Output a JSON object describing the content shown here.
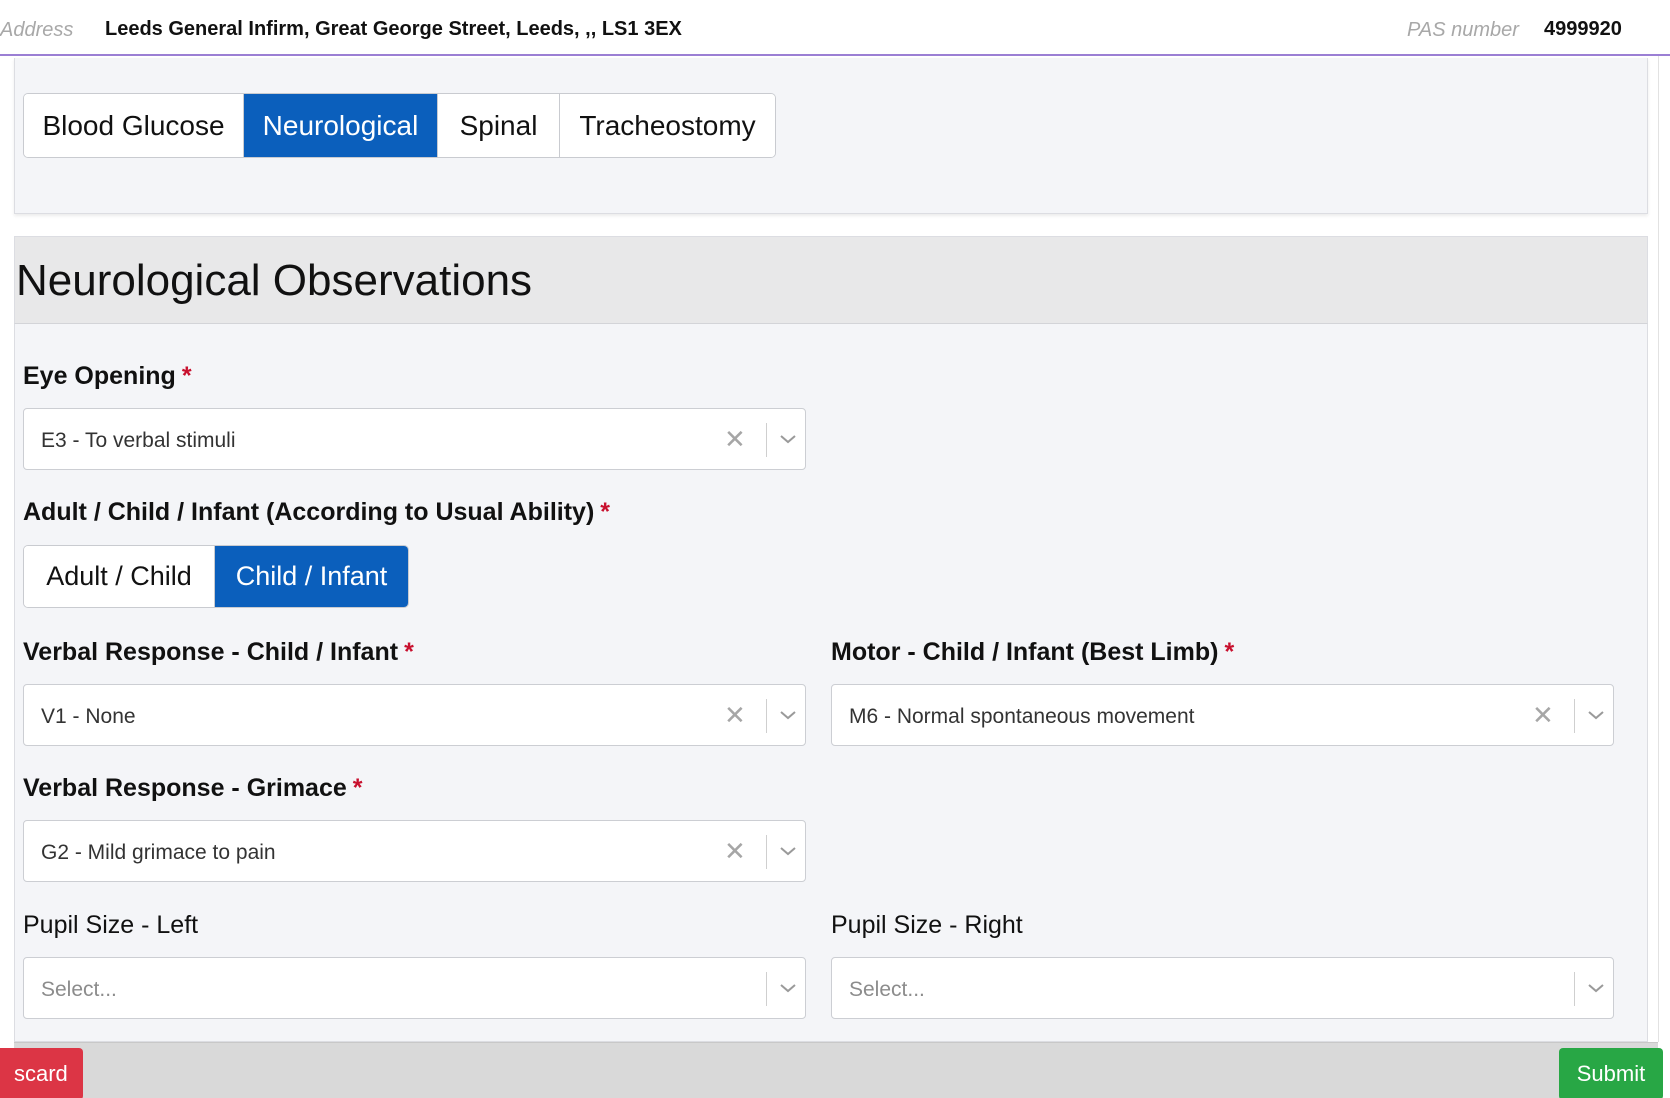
{
  "patient": {
    "address_label": "Address",
    "address_value": "Leeds General Infirm, Great George Street, Leeds, ,, LS1 3EX",
    "pas_label": "PAS number",
    "pas_value": "4999920"
  },
  "tabs": [
    {
      "label": "Blood Glucose",
      "active": false
    },
    {
      "label": "Neurological",
      "active": true
    },
    {
      "label": "Spinal",
      "active": false
    },
    {
      "label": "Tracheostomy",
      "active": false
    }
  ],
  "section": {
    "title": "Neurological Observations"
  },
  "fields": {
    "eye_opening": {
      "label": "Eye Opening",
      "required": "*",
      "value": "E3 - To verbal stimuli"
    },
    "ability": {
      "label": "Adult / Child / Infant (According to Usual Ability)",
      "required": "*",
      "options": [
        {
          "label": "Adult / Child",
          "active": false
        },
        {
          "label": "Child / Infant",
          "active": true
        }
      ]
    },
    "verbal_child": {
      "label": "Verbal Response - Child / Infant",
      "required": "*",
      "value": "V1 - None"
    },
    "motor_child": {
      "label": "Motor - Child / Infant (Best Limb)",
      "required": "*",
      "value": "M6 - Normal spontaneous movement"
    },
    "verbal_grimace": {
      "label": "Verbal Response - Grimace",
      "required": "*",
      "value": "G2 - Mild grimace to pain"
    },
    "pupil_left": {
      "label": "Pupil Size - Left",
      "placeholder": "Select..."
    },
    "pupil_right": {
      "label": "Pupil Size - Right",
      "placeholder": "Select..."
    }
  },
  "footer": {
    "discard_label": "scard",
    "submit_label": "Submit"
  },
  "colors": {
    "accent_blue": "#0b5fbc",
    "required_red": "#c8102e",
    "discard_red": "#dc3545",
    "submit_green": "#28a745",
    "header_rule_purple": "#9b7fd4"
  },
  "icons": {
    "clear": "close-icon",
    "dropdown": "chevron-down-icon"
  }
}
